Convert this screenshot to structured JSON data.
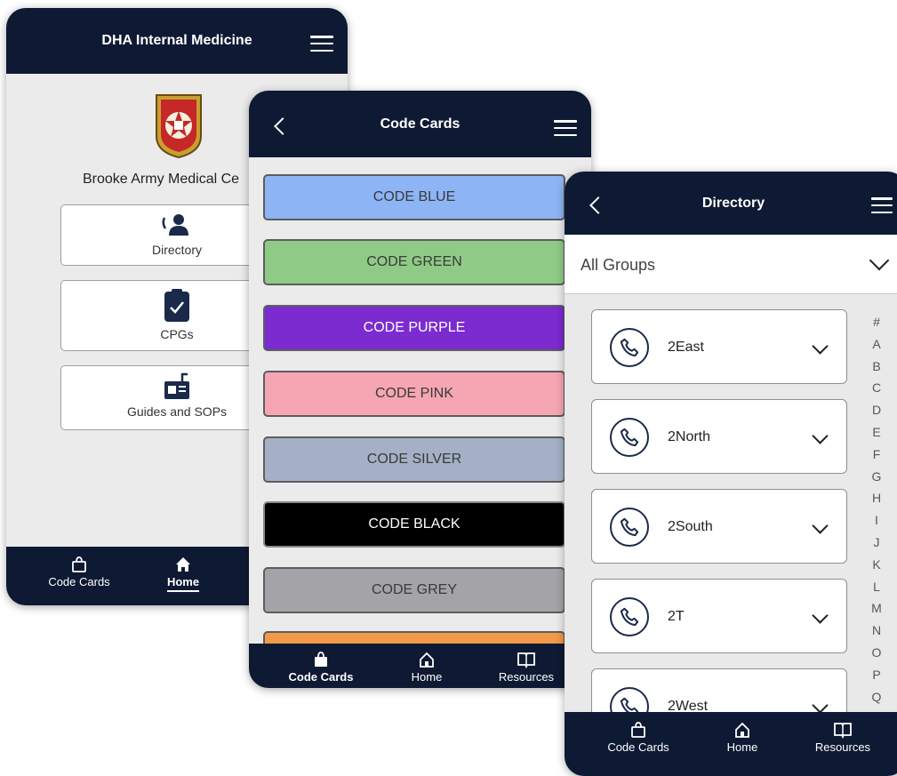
{
  "screen1": {
    "title": "DHA Internal Medicine",
    "hospital": "Brooke Army Medical Ce",
    "tiles": [
      {
        "label": "Directory",
        "icon": "directory-icon"
      },
      {
        "label": "CPGs",
        "icon": "clipboard-check-icon"
      },
      {
        "label": "Guides and SOPs",
        "icon": "guides-icon"
      }
    ],
    "footer": {
      "code_cards": "Code Cards",
      "home": "Home"
    }
  },
  "screen2": {
    "title": "Code Cards",
    "codes": [
      {
        "label": "CODE BLUE",
        "color": "#8db4f5"
      },
      {
        "label": "CODE GREEN",
        "color": "#8fcb86"
      },
      {
        "label": "CODE PURPLE",
        "color": "#7b2bd0"
      },
      {
        "label": "CODE PINK",
        "color": "#f5a6b2"
      },
      {
        "label": "CODE SILVER",
        "color": "#a3b0c5"
      },
      {
        "label": "CODE BLACK",
        "color": "#000000"
      },
      {
        "label": "CODE GREY",
        "color": "#a3a3a8"
      }
    ],
    "footer": {
      "code_cards": "Code Cards",
      "home": "Home",
      "resources": "Resources"
    }
  },
  "screen3": {
    "title": "Directory",
    "filter": "All Groups",
    "entries": [
      "2East",
      "2North",
      "2South",
      "2T",
      "2West"
    ],
    "alphabet": [
      "#",
      "A",
      "B",
      "C",
      "D",
      "E",
      "F",
      "G",
      "H",
      "I",
      "J",
      "K",
      "L",
      "M",
      "N",
      "O",
      "P",
      "Q"
    ],
    "footer": {
      "code_cards": "Code Cards",
      "home": "Home",
      "resources": "Resources"
    }
  },
  "colors": {
    "header": "#0e1a33",
    "accent_orange": "#f2994a"
  }
}
